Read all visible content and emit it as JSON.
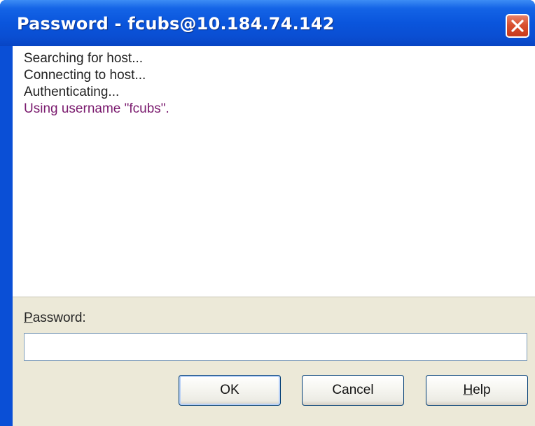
{
  "window": {
    "title": "Password - fcubs@10.184.74.142",
    "close_label": "Close"
  },
  "output": {
    "lines": [
      "Searching for host...",
      "Connecting to host...",
      "Authenticating...",
      "Using username \"fcubs\"."
    ]
  },
  "password": {
    "label_mnemonic": "P",
    "label_rest": "assword:",
    "value": "",
    "placeholder": ""
  },
  "buttons": {
    "ok": "OK",
    "cancel": "Cancel",
    "help_mnemonic": "H",
    "help_rest": "elp"
  },
  "colors": {
    "titlebar": "#0a55dc",
    "close_button": "#d9502f",
    "dialog_face": "#ece9d8",
    "username_line": "#7a1a6e"
  },
  "icons": {
    "close": "close-icon"
  }
}
